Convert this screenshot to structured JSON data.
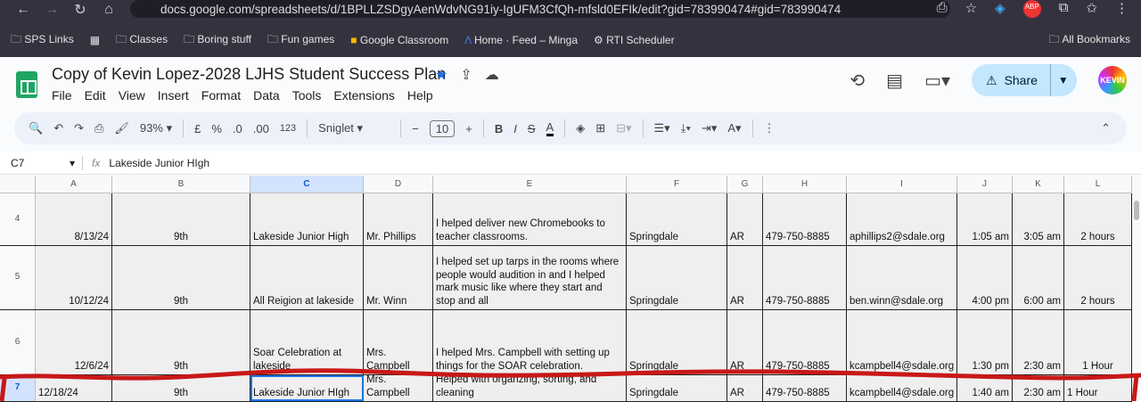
{
  "browser": {
    "url": "docs.google.com/spreadsheets/d/1BPLLZSDgyAenWdvNG91iy-IgUFM3CfQh-mfsld0EFIk/edit?gid=783990474#gid=783990474",
    "bookmarks": [
      "SPS Links",
      "Classes",
      "Boring stuff",
      "Fun games",
      "Google Classroom",
      "Home · Feed – Minga",
      "RTI Scheduler"
    ],
    "all_bookmarks": "All Bookmarks",
    "abp": "ABP"
  },
  "doc": {
    "title": "Copy of  Kevin Lopez-2028 LJHS Student Success Plan",
    "menu": [
      "File",
      "Edit",
      "View",
      "Insert",
      "Format",
      "Data",
      "Tools",
      "Extensions",
      "Help"
    ],
    "share": "Share",
    "avatar": "KEVIN"
  },
  "toolbar": {
    "zoom": "93%",
    "currency": "£",
    "percent": "%",
    "dec_less": ".0",
    "dec_more": ".00",
    "num_format": "123",
    "font": "Sniglet",
    "font_size": "10"
  },
  "formula": {
    "cell": "C7",
    "fx": "fx",
    "value": "Lakeside Junior HIgh"
  },
  "columns": [
    "A",
    "B",
    "C",
    "D",
    "E",
    "F",
    "G",
    "H",
    "I",
    "J",
    "K",
    "L"
  ],
  "rows": [
    {
      "n": "4",
      "cells": [
        "8/13/24",
        "9th",
        "Lakeside Junior High",
        "Mr. Phillips",
        "I helped deliver new Chromebooks to teacher classrooms.",
        "Springdale",
        "AR",
        "479-750-8885",
        "aphillips2@sdale.org",
        "1:05 am",
        "3:05 am",
        "2 hours"
      ]
    },
    {
      "n": "5",
      "cells": [
        "10/12/24",
        "9th",
        "All Reigion at lakeside",
        "Mr. Winn",
        "I helped set up tarps in the rooms where people would audition in and I helped mark music like where they start and stop and all",
        "Springdale",
        "AR",
        "479-750-8885",
        "ben.winn@sdale.org",
        "4:00 pm",
        "6:00 am",
        "2 hours"
      ]
    },
    {
      "n": "6",
      "cells": [
        "12/6/24",
        "9th",
        "Soar Celebration at lakeside",
        "Mrs. Campbell",
        "I helped Mrs. Campbell with setting up things for the SOAR celebration.",
        "Springdale",
        "AR",
        "479-750-8885",
        "kcampbell4@sdale.org",
        "1:30 pm",
        "2:30 am",
        "1 Hour"
      ]
    },
    {
      "n": "7",
      "cells": [
        "12/18/24",
        "9th",
        "Lakeside Junior HIgh",
        "Mrs. Campbell",
        "Helped with organzing, sorting, and cleaning",
        "Springdale",
        "AR",
        "479-750-8885",
        "kcampbell4@sdale.org",
        "1:40 am",
        "2:30 am",
        "1 Hour"
      ]
    }
  ]
}
